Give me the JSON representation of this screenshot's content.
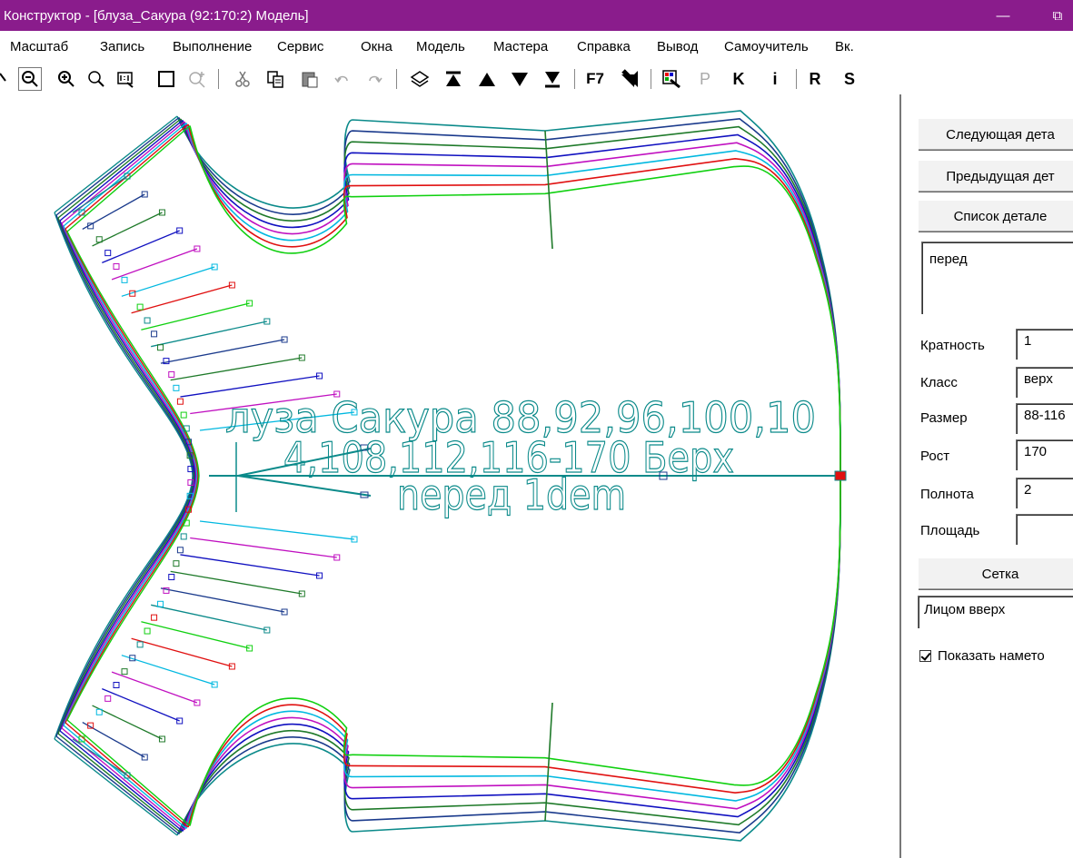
{
  "window": {
    "title": "Конструктор - [блуза_Сакура (92:170:2) Модель]",
    "minimize_glyph": "—",
    "restore_glyph": "⧉"
  },
  "menu": {
    "items": [
      "Масштаб",
      "Запись",
      "Выполнение",
      "Сервис",
      "Окна",
      "Модель",
      "Мастера",
      "Справка",
      "Вывод",
      "Самоучитель",
      "Вк."
    ]
  },
  "toolbar": {
    "f7_label": "F7",
    "p_label": "P",
    "k_label": "K",
    "i_label": "i",
    "r_label": "R",
    "s_label": "S"
  },
  "canvas": {
    "pattern_text_line1": "лузa  Сакура  88,92,96,100,10",
    "pattern_text_line2": "4,108,112,116-170  Берх",
    "pattern_text_line3": "nepeд  1dem",
    "size_colors": [
      "#0b8a8a",
      "#1a3a8c",
      "#1f7a2a",
      "#1010c0",
      "#c010c0",
      "#00b8e0",
      "#e01010",
      "#10d010"
    ]
  },
  "panel": {
    "next_detail_button": "Следующая дета",
    "prev_detail_button": "Предыдущая дет",
    "detail_list_button": "Список детале",
    "detail_name": "перед",
    "multiplicity_label": "Кратность",
    "multiplicity_value": "1",
    "class_label": "Класс",
    "class_value": "верх",
    "size_label": "Размер",
    "size_value": "88-116",
    "height_label": "Рост",
    "height_value": "170",
    "fullness_label": "Полнота",
    "fullness_value": "2",
    "area_label": "Площадь",
    "area_value": "",
    "grid_button": "Сетка",
    "face_select_value": "Лицом вверх",
    "show_basting_label": "Показать намето"
  }
}
